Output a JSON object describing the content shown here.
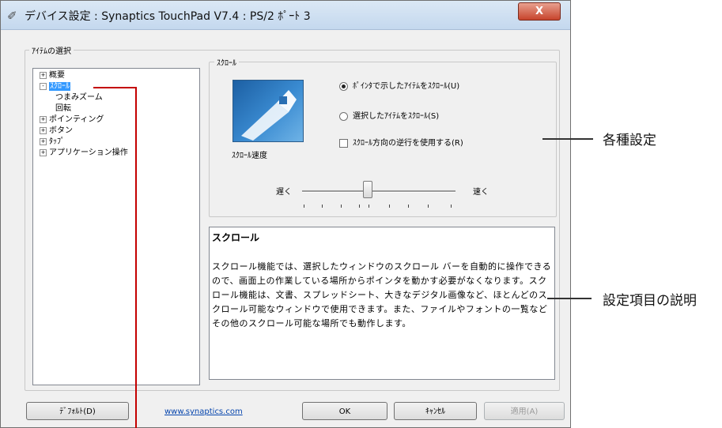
{
  "window": {
    "title": "デバイス設定 : Synaptics TouchPad V7.4 : PS/2 ﾎﾟｰﾄ 3",
    "close": "X"
  },
  "item_select": {
    "legend": "ｱｲﾃﾑの選択",
    "tree": [
      {
        "label": "概要",
        "expander": "+"
      },
      {
        "label": "ｽｸﾛｰﾙ",
        "expander": "-",
        "selected": true
      },
      {
        "label": "つまみズーム"
      },
      {
        "label": "回転"
      },
      {
        "label": "ポインティング",
        "expander": "+"
      },
      {
        "label": "ボタン",
        "expander": "+"
      },
      {
        "label": "ﾀｯﾌﾟ",
        "expander": "+"
      },
      {
        "label": "アプリケーション操作",
        "expander": "+"
      }
    ]
  },
  "scroll_group": {
    "legend": "ｽｸﾛｰﾙ",
    "speed_label": "ｽｸﾛｰﾙ速度",
    "options": {
      "radio1": "ﾎﾟｲﾝﾀで示したｱｲﾃﾑをｽｸﾛｰﾙ(U)",
      "radio2": "選択したｱｲﾃﾑをｽｸﾛｰﾙ(S)",
      "checkbox": "ｽｸﾛｰﾙ方向の逆行を使用する(R)"
    },
    "slider": {
      "slow": "遅く",
      "fast": "速く",
      "value_fraction": 0.42
    }
  },
  "description": {
    "title": "スクロール",
    "body": "スクロール機能では、選択したウィンドウのスクロール バーを自動的に操作できるので、画面上の作業している場所からポインタを動かす必要がなくなります。スクロール機能は、文書、スプレッドシート、大きなデジタル画像など、ほとんどのスクロール可能なウィンドウで使用できます。また、ファイルやフォントの一覧などその他のスクロール可能な場所でも動作します。"
  },
  "buttons": {
    "default": "ﾃﾞﾌｫﾙﾄ(D)",
    "link": "www.synaptics.com",
    "ok": "OK",
    "cancel": "ｷｬﾝｾﾙ",
    "apply": "適用(A)"
  },
  "callouts": {
    "settings": "各種設定",
    "explanation": "設定項目の説明"
  }
}
